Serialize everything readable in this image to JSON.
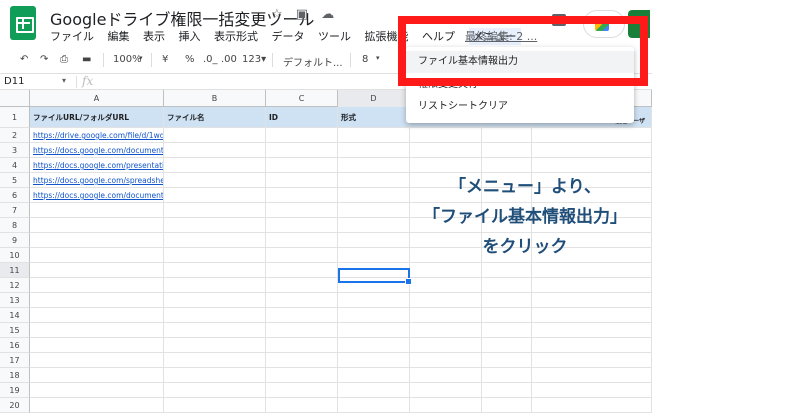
{
  "title": "Googleドライブ権限一括変更ツール",
  "menubar": [
    "ファイル",
    "編集",
    "表示",
    "挿入",
    "表示形式",
    "データ",
    "ツール",
    "拡張機能",
    "ヘルプ"
  ],
  "custom_menu": "メニュー",
  "last_edit": "最終編集: 2 ...",
  "toolbar": {
    "zoom": "100%",
    "currency": "¥",
    "percent": "%",
    "dec_decrease": ".0_",
    "dec_increase": ".00",
    "format_123": "123▾",
    "font": "デフォルト...",
    "font_size": "8"
  },
  "namebox": "D11",
  "fx": "fx",
  "columns": [
    "A",
    "B",
    "C",
    "D"
  ],
  "rows": [
    "1",
    "2",
    "3",
    "4",
    "5",
    "6",
    "7",
    "8",
    "9",
    "10",
    "11",
    "12",
    "13",
    "14",
    "15",
    "16",
    "17",
    "18",
    "19",
    "20"
  ],
  "header_cells": {
    "a": "ファイルURL/フォルダURL",
    "b": "ファイル名",
    "c": "ID",
    "d": "形式",
    "partial_right": "最近ユーザ"
  },
  "links": [
    "https://drive.google.com/file/d/1wd0thT",
    "https://docs.google.com/document/d/1L",
    "https://docs.google.com/presentation/d",
    "https://docs.google.com/spreadsheets/d",
    "https://docs.google.com/document/d/1I"
  ],
  "dropdown": {
    "items": [
      "ファイル基本情報出力",
      "権限変更実行",
      "リストシートクリア"
    ]
  },
  "annotation": {
    "line1": "「メニュー」より、",
    "line2": "「ファイル基本情報出力」",
    "line3": "をクリック"
  },
  "colors": {
    "highlight": "#ff1a1a",
    "annotation": "#1f4e79",
    "header_fill": "#cfe2f3"
  }
}
